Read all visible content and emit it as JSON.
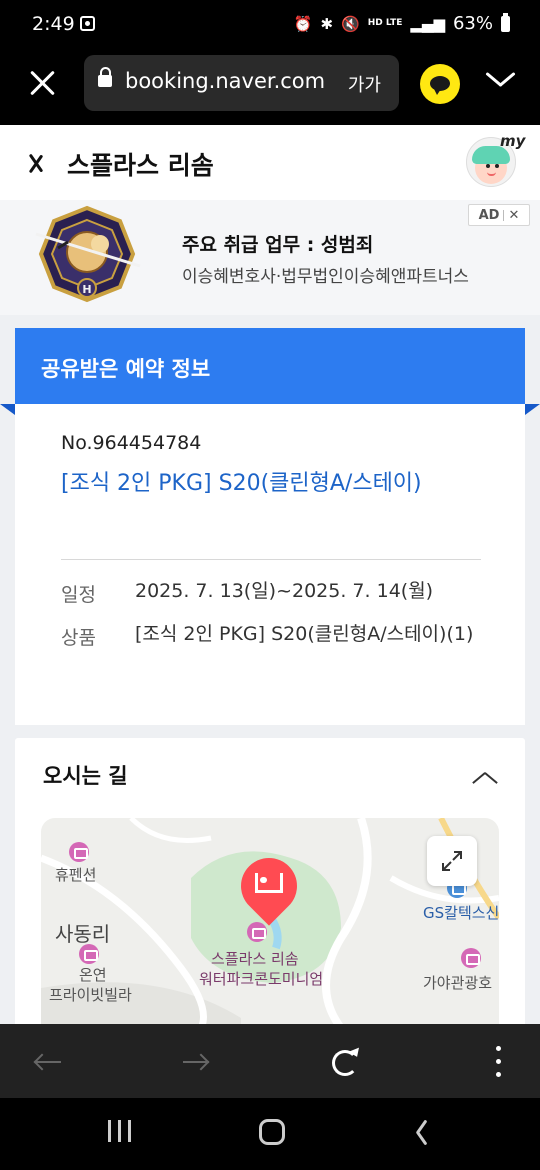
{
  "status_bar": {
    "time": "2:49",
    "network_badge": "HD LTE",
    "battery": "63%"
  },
  "browser": {
    "url": "booking.naver.com",
    "text_size_label": "가가"
  },
  "header": {
    "title": "스플라스 리솜",
    "my_label": "my"
  },
  "ad": {
    "badge": "AD",
    "title": "주요 취급 업무 : 성범죄",
    "subtitle": "이승혜변호사·법무법인이승혜앤파트너스"
  },
  "reservation": {
    "section_title": "공유받은 예약 정보",
    "number": "No.964454784",
    "product_name": "[조식 2인 PKG] S20(클린형A/스테이)",
    "rows": [
      {
        "label": "일정",
        "value": "2025. 7. 13(일)~2025. 7. 14(월)"
      },
      {
        "label": "상품",
        "value": "[조식 2인 PKG] S20(클린형A/스테이)(1)"
      }
    ]
  },
  "directions": {
    "title": "오시는 길",
    "map_labels": {
      "pension": "휴펜션",
      "village": "사동리",
      "villa_1": "온연",
      "villa_2": "프라이빗빌라",
      "resort_1": "스플라스 리솜",
      "resort_2": "워터파크콘도미니엄",
      "gas_station": "GS칼텍스신",
      "hotel": "가야관광호"
    }
  },
  "colors": {
    "accent_blue": "#2d7cf0",
    "link_blue": "#1d64c8",
    "pin_red": "#ff4b52",
    "kakao_yellow": "#ffe812"
  }
}
